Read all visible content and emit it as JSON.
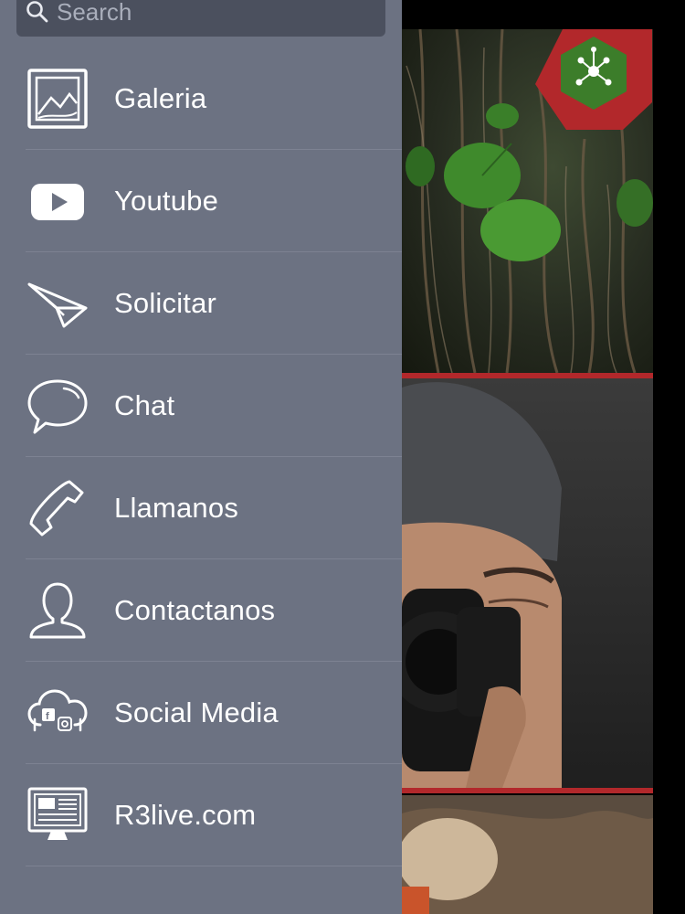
{
  "search": {
    "placeholder": "Search"
  },
  "menu": {
    "items": [
      {
        "label": "Galeria",
        "icon": "gallery-icon"
      },
      {
        "label": "Youtube",
        "icon": "youtube-icon"
      },
      {
        "label": "Solicitar",
        "icon": "paper-plane-icon"
      },
      {
        "label": "Chat",
        "icon": "chat-bubble-icon"
      },
      {
        "label": "Llamanos",
        "icon": "phone-icon"
      },
      {
        "label": "Contactanos",
        "icon": "person-icon"
      },
      {
        "label": "Social Media",
        "icon": "cloud-social-icon"
      },
      {
        "label": "R3live.com",
        "icon": "monitor-website-icon"
      }
    ]
  },
  "colors": {
    "drawer_bg": "#6c7282",
    "search_bg": "#4b505e",
    "accent_red": "#b2282b",
    "text": "#ffffff"
  }
}
